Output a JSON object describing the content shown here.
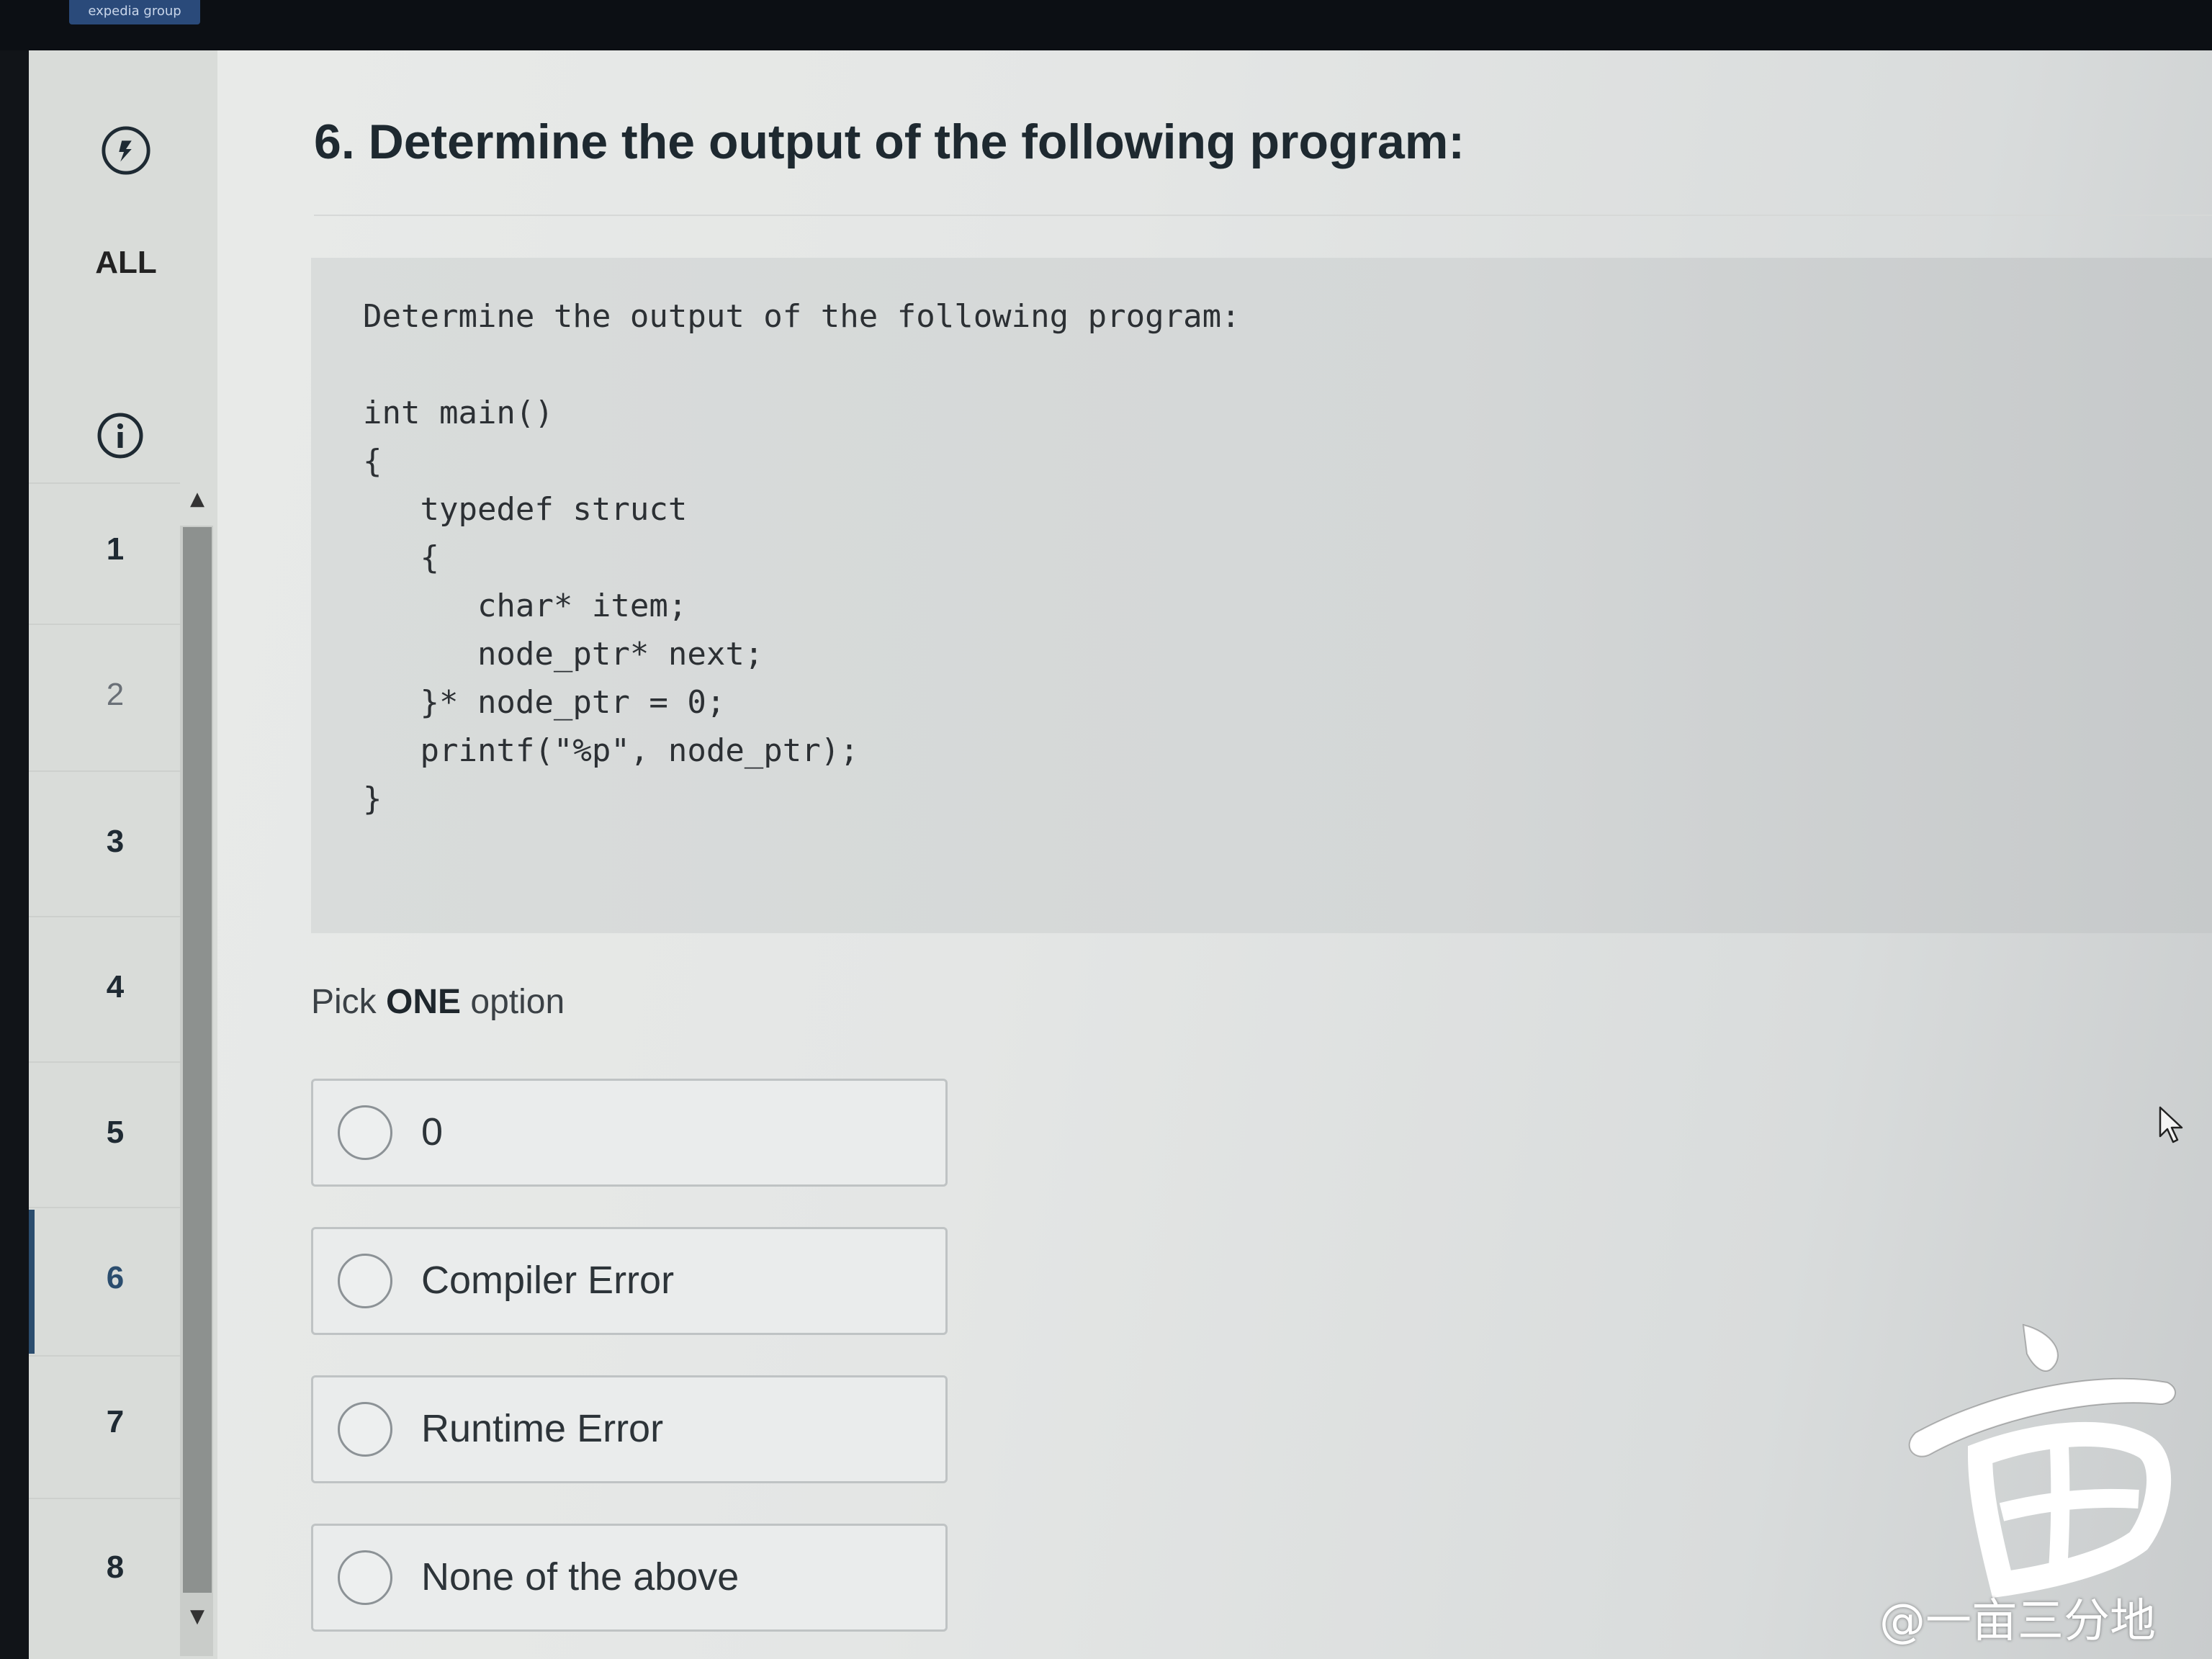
{
  "topbar": {
    "brand": "expedia group"
  },
  "sidebar": {
    "all_label": "ALL",
    "top_icon": "clock-icon",
    "info_icon": "info-icon",
    "questions": [
      {
        "label": "1",
        "state": "answered"
      },
      {
        "label": "2",
        "state": "unanswered"
      },
      {
        "label": "3",
        "state": "answered"
      },
      {
        "label": "4",
        "state": "answered"
      },
      {
        "label": "5",
        "state": "answered"
      },
      {
        "label": "6",
        "state": "active"
      },
      {
        "label": "7",
        "state": "answered"
      },
      {
        "label": "8",
        "state": "answered"
      }
    ],
    "active_color": "#2b4d6e"
  },
  "question": {
    "title": "6. Determine the output of the following program:",
    "code": "Determine the output of the following program:\n\nint main()\n{\n   typedef struct\n   {\n      char* item;\n      node_ptr* next;\n   }* node_ptr = 0;\n   printf(\"%p\", node_ptr);\n}",
    "pick_prefix": "Pick ",
    "pick_emphasis": "ONE",
    "pick_suffix": " option",
    "options": [
      {
        "label": "0",
        "selected": false
      },
      {
        "label": "Compiler Error",
        "selected": false
      },
      {
        "label": "Runtime Error",
        "selected": false
      },
      {
        "label": "None of the above",
        "selected": false
      }
    ]
  },
  "watermark": {
    "text": "@一亩三分地",
    "logo": "mu-calligraphy-logo"
  }
}
